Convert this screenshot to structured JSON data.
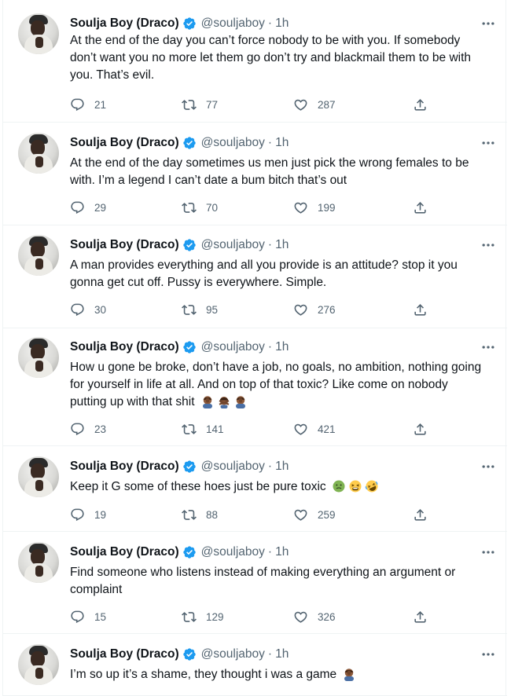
{
  "author": {
    "name": "Soulja Boy (Draco)",
    "handle": "@souljaboy",
    "separator": "·",
    "time": "1h",
    "verified_color": "#1d9bf0"
  },
  "icons": {
    "reply": "reply-icon",
    "retweet": "retweet-icon",
    "like": "like-icon",
    "share": "share-icon",
    "more": "more-icon",
    "verified": "verified-badge-icon"
  },
  "tweets": [
    {
      "lines": [
        "At the end of the day you can’t force nobody to be with you. If somebody",
        "don’t want you no more let them go don’t try and blackmail them to be with",
        "you. That’s evil."
      ],
      "replies": "21",
      "retweets": "77",
      "likes": "287",
      "emojis": []
    },
    {
      "lines": [
        "At the end of the day sometimes us men just pick the wrong females to be",
        "with. I’m a legend I can’t date a bum bitch that’s out"
      ],
      "replies": "29",
      "retweets": "70",
      "likes": "199",
      "emojis": []
    },
    {
      "lines": [
        "A man provides everything and all you provide is an attitude? stop it you",
        "gonna get cut off. Pussy is everywhere. Simple."
      ],
      "replies": "30",
      "retweets": "95",
      "likes": "276",
      "emojis": []
    },
    {
      "lines": [
        "How u gone be broke, don’t have a job, no goals, no ambition, nothing going",
        "for yourself in life at all. And on top of that toxic? Like come on nobody",
        "putting up with that shit"
      ],
      "replies": "23",
      "retweets": "141",
      "likes": "421",
      "emojis": [
        "man-facepalming",
        "man-gesturing-no",
        "man-facepalming"
      ]
    },
    {
      "lines": [
        "Keep it G some of these hoes just be pure toxic"
      ],
      "replies": "19",
      "retweets": "88",
      "likes": "259",
      "emojis": [
        "nauseated-face",
        "tired-face",
        "rofl-face"
      ]
    },
    {
      "lines": [
        "Find someone who listens instead of making everything an argument or",
        "complaint"
      ],
      "replies": "15",
      "retweets": "129",
      "likes": "326",
      "emojis": []
    },
    {
      "lines": [
        "I’m so up it’s a shame, they thought i was a game"
      ],
      "replies": "",
      "retweets": "",
      "likes": "",
      "emojis": [
        "man-facepalming"
      ]
    }
  ]
}
